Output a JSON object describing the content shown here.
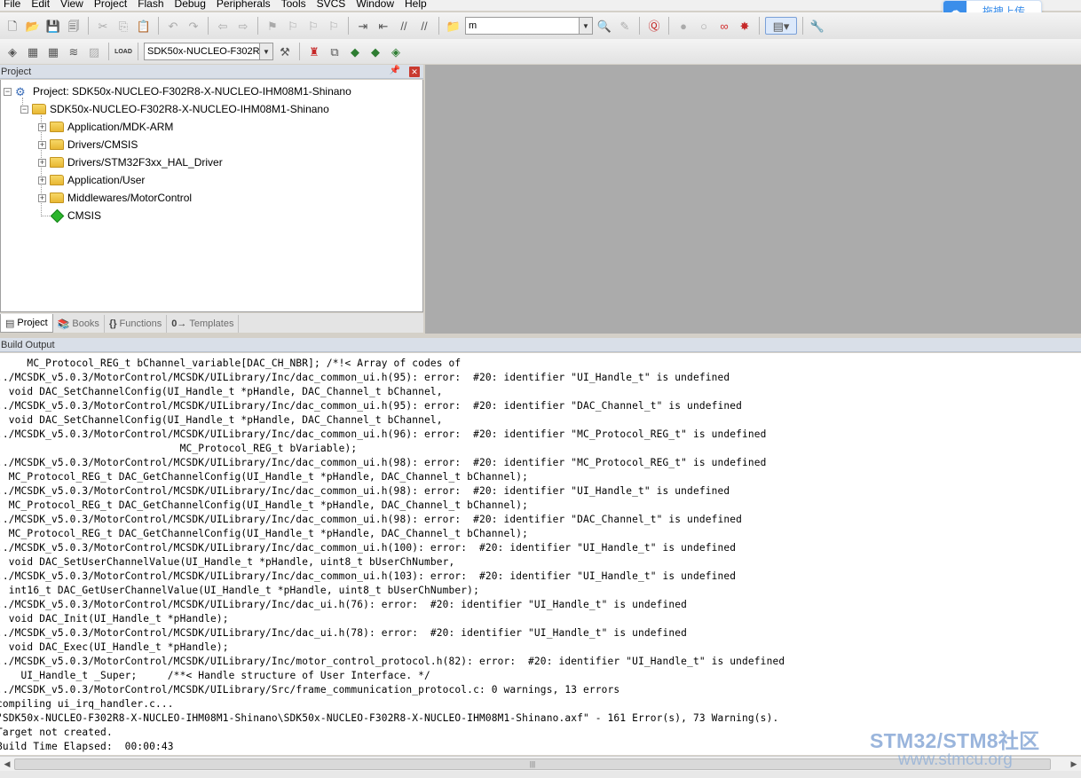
{
  "menu": [
    "File",
    "Edit",
    "View",
    "Project",
    "Flash",
    "Debug",
    "Peripherals",
    "Tools",
    "SVCS",
    "Window",
    "Help"
  ],
  "toolbar": {
    "find_value": "m",
    "target_select": "SDK50x-NUCLEO-F302R8",
    "load_label": "LOAD"
  },
  "cloud_button": {
    "label": "拖拽上传"
  },
  "project_pane": {
    "title": "Project",
    "root": "Project: SDK50x-NUCLEO-F302R8-X-NUCLEO-IHM08M1-Shinano",
    "target": "SDK50x-NUCLEO-F302R8-X-NUCLEO-IHM08M1-Shinano",
    "groups": [
      "Application/MDK-ARM",
      "Drivers/CMSIS",
      "Drivers/STM32F3xx_HAL_Driver",
      "Application/User",
      "Middlewares/MotorControl"
    ],
    "component": "CMSIS",
    "tabs": [
      "Project",
      "Books",
      "Functions",
      "Templates"
    ]
  },
  "build_output": {
    "title": "Build Output",
    "lines": [
      "     MC_Protocol_REG_t bChannel_variable[DAC_CH_NBR]; /*!< Array of codes of",
      "../MCSDK_v5.0.3/MotorControl/MCSDK/UILibrary/Inc/dac_common_ui.h(95): error:  #20: identifier \"UI_Handle_t\" is undefined",
      "  void DAC_SetChannelConfig(UI_Handle_t *pHandle, DAC_Channel_t bChannel,",
      "../MCSDK_v5.0.3/MotorControl/MCSDK/UILibrary/Inc/dac_common_ui.h(95): error:  #20: identifier \"DAC_Channel_t\" is undefined",
      "  void DAC_SetChannelConfig(UI_Handle_t *pHandle, DAC_Channel_t bChannel,",
      "../MCSDK_v5.0.3/MotorControl/MCSDK/UILibrary/Inc/dac_common_ui.h(96): error:  #20: identifier \"MC_Protocol_REG_t\" is undefined",
      "                              MC_Protocol_REG_t bVariable);",
      "../MCSDK_v5.0.3/MotorControl/MCSDK/UILibrary/Inc/dac_common_ui.h(98): error:  #20: identifier \"MC_Protocol_REG_t\" is undefined",
      "  MC_Protocol_REG_t DAC_GetChannelConfig(UI_Handle_t *pHandle, DAC_Channel_t bChannel);",
      "../MCSDK_v5.0.3/MotorControl/MCSDK/UILibrary/Inc/dac_common_ui.h(98): error:  #20: identifier \"UI_Handle_t\" is undefined",
      "  MC_Protocol_REG_t DAC_GetChannelConfig(UI_Handle_t *pHandle, DAC_Channel_t bChannel);",
      "../MCSDK_v5.0.3/MotorControl/MCSDK/UILibrary/Inc/dac_common_ui.h(98): error:  #20: identifier \"DAC_Channel_t\" is undefined",
      "  MC_Protocol_REG_t DAC_GetChannelConfig(UI_Handle_t *pHandle, DAC_Channel_t bChannel);",
      "../MCSDK_v5.0.3/MotorControl/MCSDK/UILibrary/Inc/dac_common_ui.h(100): error:  #20: identifier \"UI_Handle_t\" is undefined",
      "  void DAC_SetUserChannelValue(UI_Handle_t *pHandle, uint8_t bUserChNumber,",
      "../MCSDK_v5.0.3/MotorControl/MCSDK/UILibrary/Inc/dac_common_ui.h(103): error:  #20: identifier \"UI_Handle_t\" is undefined",
      "  int16_t DAC_GetUserChannelValue(UI_Handle_t *pHandle, uint8_t bUserChNumber);",
      "../MCSDK_v5.0.3/MotorControl/MCSDK/UILibrary/Inc/dac_ui.h(76): error:  #20: identifier \"UI_Handle_t\" is undefined",
      "  void DAC_Init(UI_Handle_t *pHandle);",
      "../MCSDK_v5.0.3/MotorControl/MCSDK/UILibrary/Inc/dac_ui.h(78): error:  #20: identifier \"UI_Handle_t\" is undefined",
      "  void DAC_Exec(UI_Handle_t *pHandle);",
      "../MCSDK_v5.0.3/MotorControl/MCSDK/UILibrary/Inc/motor_control_protocol.h(82): error:  #20: identifier \"UI_Handle_t\" is undefined",
      "    UI_Handle_t _Super;     /**< Handle structure of User Interface. */",
      "../MCSDK_v5.0.3/MotorControl/MCSDK/UILibrary/Src/frame_communication_protocol.c: 0 warnings, 13 errors",
      "compiling ui_irq_handler.c...",
      "\"SDK50x-NUCLEO-F302R8-X-NUCLEO-IHM08M1-Shinano\\SDK50x-NUCLEO-F302R8-X-NUCLEO-IHM08M1-Shinano.axf\" - 161 Error(s), 73 Warning(s).",
      "Target not created.",
      "Build Time Elapsed:  00:00:43"
    ]
  },
  "watermark": {
    "line1": "STM32/STM8社区",
    "line2": "www.stmcu.org"
  }
}
